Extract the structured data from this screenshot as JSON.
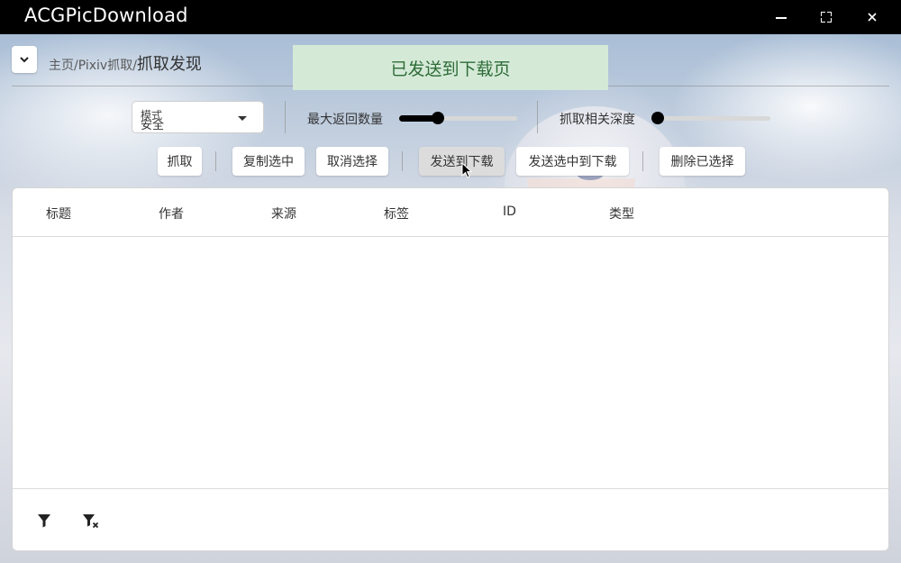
{
  "window": {
    "title": "ACGPicDownload",
    "controls": [
      "minimize-icon",
      "maximize-icon",
      "close-icon"
    ]
  },
  "header": {
    "breadcrumb": [
      {
        "label": "主页"
      },
      {
        "label": "Pixiv抓取"
      }
    ],
    "current_page": "抓取发现",
    "separator": "/"
  },
  "toast": {
    "message": "已发送到下载页",
    "color": "#2e6b37",
    "background": "#d4ead7"
  },
  "controls": {
    "mode": {
      "label": "模式",
      "value": "安全"
    },
    "max_results": {
      "label": "最大返回数量",
      "value_fraction": 0.33
    },
    "related_depth": {
      "label": "抓取相关深度",
      "value_fraction": 0.0
    }
  },
  "actions": {
    "fetch": "抓取",
    "copy_selected": "复制选中",
    "clear_selection": "取消选择",
    "send_to_download": "发送到下载",
    "send_selected_to_download": "发送选中到下载",
    "delete_selected": "删除已选择"
  },
  "table": {
    "columns": [
      "标题",
      "作者",
      "来源",
      "标签",
      "ID",
      "类型"
    ],
    "rows": []
  },
  "footer": {
    "icons": [
      "filter-icon",
      "clear-filter-icon"
    ]
  }
}
